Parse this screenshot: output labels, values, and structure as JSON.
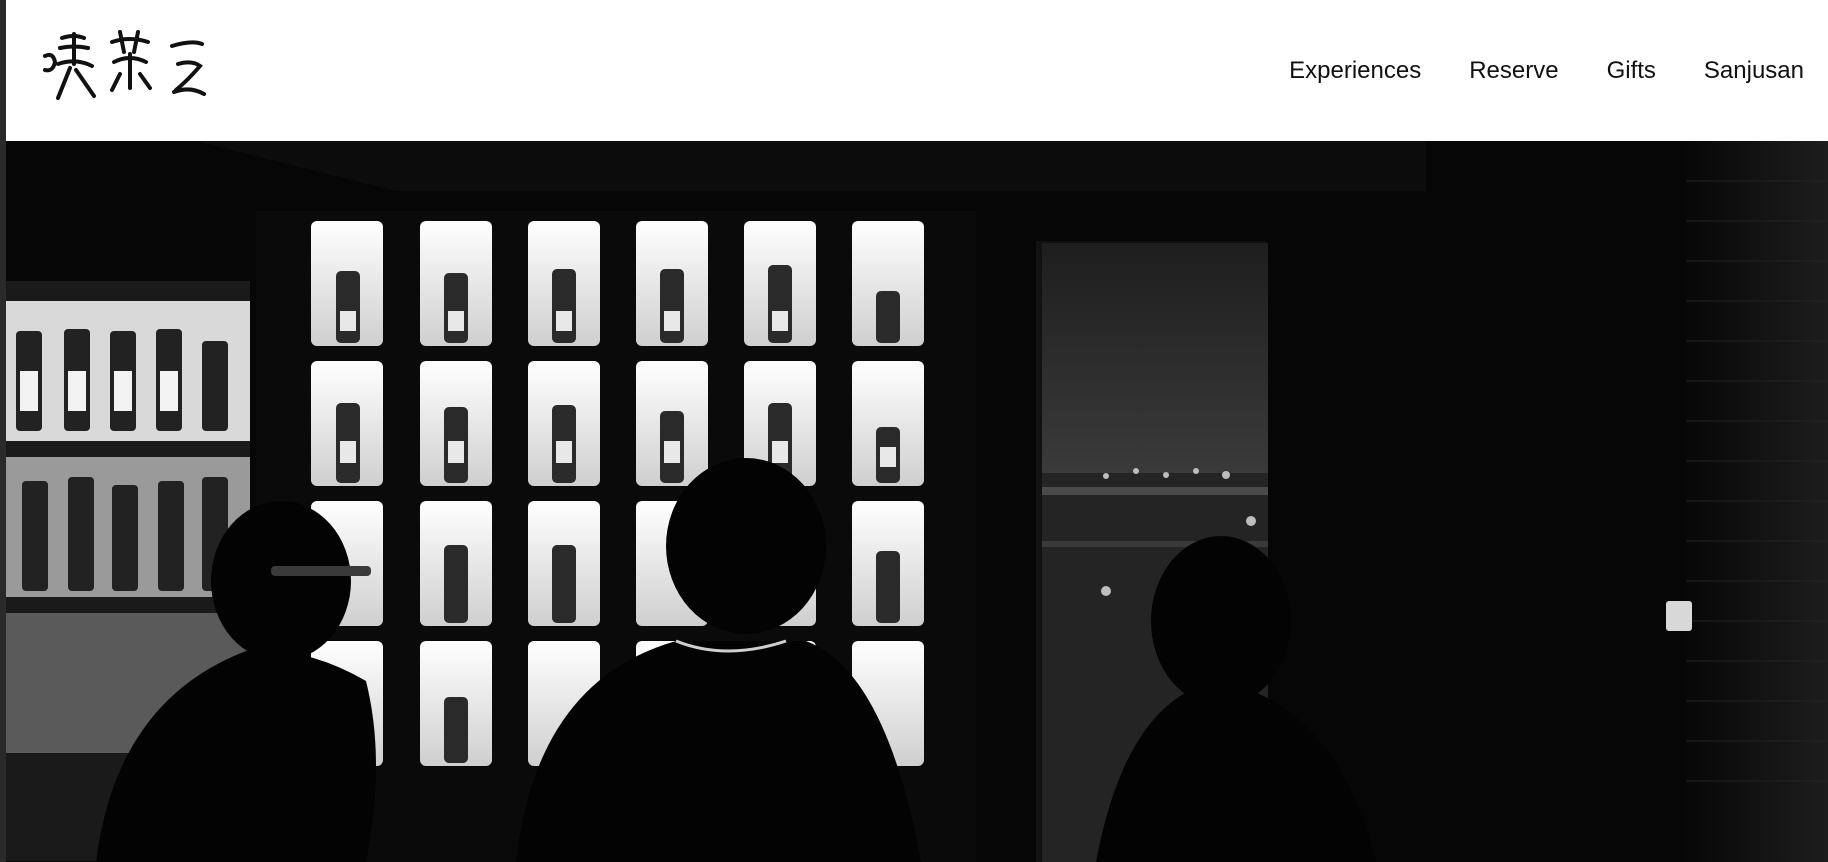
{
  "header": {
    "logo": {
      "alt_text": "喫茶三",
      "icon": "calligraphy-logo"
    },
    "nav": [
      {
        "label": "Experiences"
      },
      {
        "label": "Reserve"
      },
      {
        "label": "Gifts"
      },
      {
        "label": "Sanjusan"
      }
    ]
  },
  "hero": {
    "image": "black-and-white photo of whisky bar with backlit bottle shelves and patrons",
    "colors": {
      "bg": "#050505",
      "lit_cell": "#f2f2f2",
      "shelf": "#1a1a1a"
    }
  }
}
